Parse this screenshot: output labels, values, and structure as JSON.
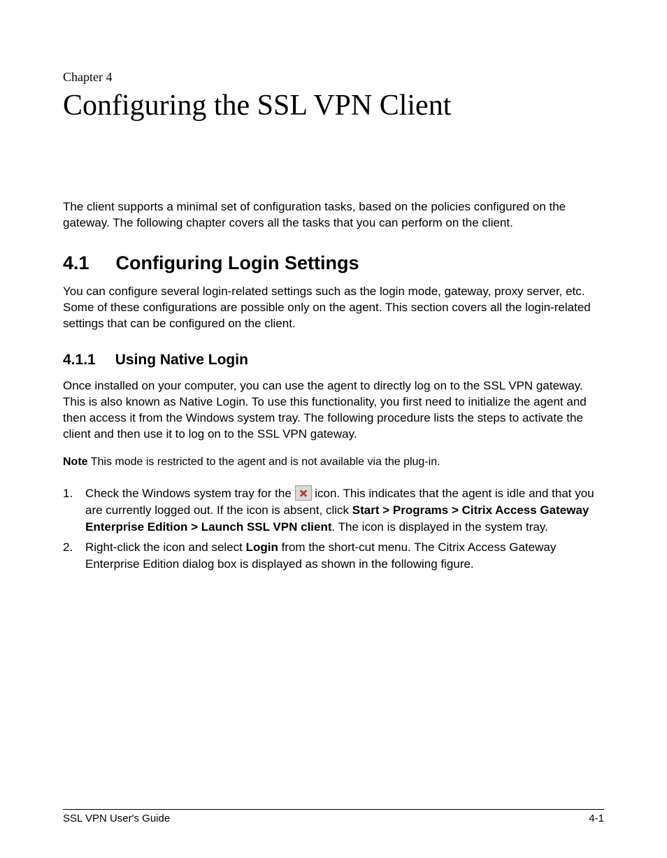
{
  "chapter": {
    "label": "Chapter 4",
    "title": "Configuring the SSL VPN Client"
  },
  "intro": "The client supports a minimal set of configuration tasks, based on the policies configured on the gateway. The following chapter covers all the tasks that you can perform on the client.",
  "section": {
    "number": "4.1",
    "title": "Configuring Login Settings",
    "para": "You can configure several login-related settings such as the login mode, gateway, proxy server, etc. Some of these configurations are possible only on the agent. This section covers all the login-related settings that can be configured on the client."
  },
  "subsection": {
    "number": "4.1.1",
    "title": "Using Native Login",
    "para": "Once installed on your computer, you can use the agent to directly log on to the SSL VPN gateway. This is also known as Native Login. To use this functionality, you first need to initialize the agent and then access it from the Windows system tray. The following procedure lists the steps to activate the client and then use it to log on to the SSL VPN gateway.",
    "note_label": "Note",
    "note_text": " This mode is restricted to the agent and is not available via the plug-in."
  },
  "steps": {
    "step1_pre": "Check the Windows system tray for the ",
    "step1_mid": " icon. This indicates that the agent is idle and that you are currently logged out. If the icon is absent, click ",
    "step1_bold": "Start > Programs > Citrix Access Gateway Enterprise Edition > Launch SSL VPN client",
    "step1_post": ". The icon is displayed in the system tray.",
    "step2_pre": "Right-click the icon and select ",
    "step2_bold": "Login",
    "step2_post": " from the short-cut menu. The Citrix Access Gateway Enterprise Edition dialog box is displayed as shown in the following figure."
  },
  "icons": {
    "tray_icon_name": "citrix-agent-tray-icon"
  },
  "footer": {
    "left": "SSL VPN User's Guide",
    "right": "4-1"
  }
}
